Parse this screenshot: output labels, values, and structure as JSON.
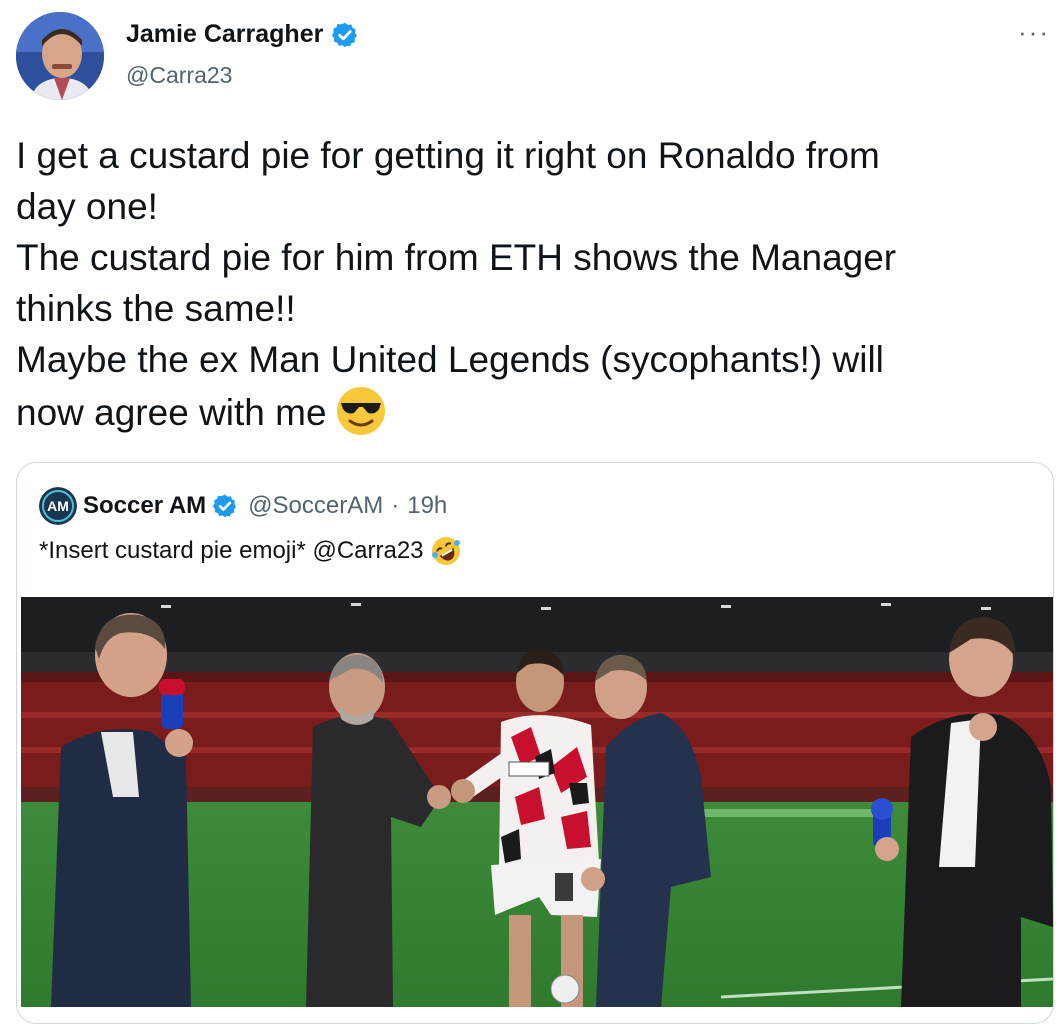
{
  "tweet": {
    "author": {
      "name": "Jamie Carragher",
      "handle": "@Carra23",
      "avatar_icon": "avatar-photo",
      "verified_icon": "verified-badge-icon"
    },
    "more_icon": "···",
    "text_lines": [
      "I get a custard pie for getting it right on Ronaldo from",
      "day one!",
      "The custard pie for him from ETH shows the Manager",
      "thinks the same!!",
      "Maybe the ex Man United Legends (sycophants!) will",
      "now agree with me"
    ],
    "text_emoji": "smiling-face-with-sunglasses-icon"
  },
  "quote": {
    "name": "Soccer AM",
    "handle": "@SoccerAM",
    "separator": "·",
    "time": "19h",
    "text": "*Insert custard pie emoji* @Carra23",
    "text_emoji": "rolling-on-floor-laughing-icon",
    "logo_text": "AM",
    "media_icon": "stadium-photo"
  },
  "colors": {
    "verified_blue": "#1d9bf0",
    "text_primary": "#0f1419",
    "text_secondary": "#536471",
    "border": "#cfd9de",
    "soccer_am_teal": "#1a3550"
  }
}
